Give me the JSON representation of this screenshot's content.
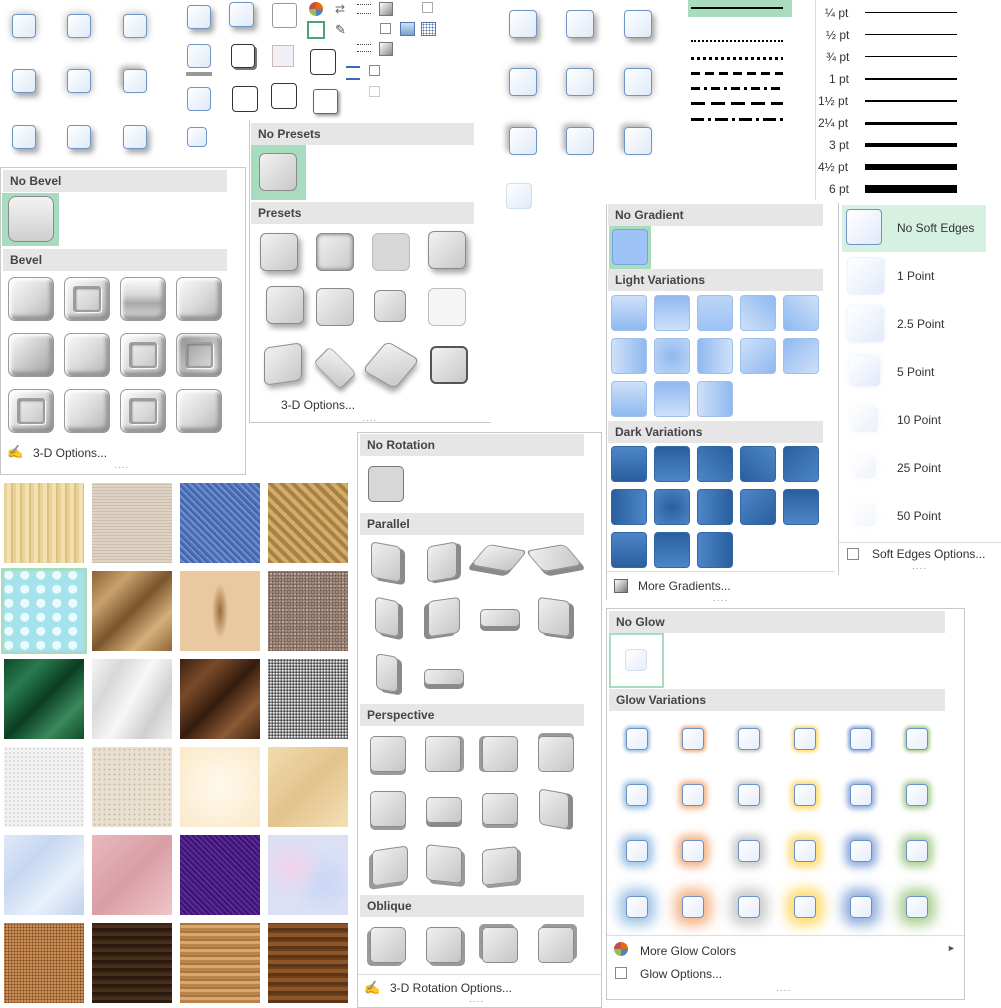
{
  "bevel_panel": {
    "no_bevel": "No Bevel",
    "bevel": "Bevel",
    "options": "3-D Options..."
  },
  "presets_panel": {
    "no_presets": "No Presets",
    "presets": "Presets",
    "options": "3-D Options..."
  },
  "rotation_panel": {
    "no_rotation": "No Rotation",
    "parallel": "Parallel",
    "perspective": "Perspective",
    "oblique": "Oblique",
    "options": "3-D Rotation Options..."
  },
  "gradient_panel": {
    "no_gradient": "No Gradient",
    "light_variations": "Light Variations",
    "dark_variations": "Dark Variations",
    "more": "More Gradients..."
  },
  "glow_panel": {
    "no_glow": "No Glow",
    "glow_variations": "Glow Variations",
    "more_colors": "More Glow Colors",
    "options": "Glow Options...",
    "colors": [
      "#5b9bd5",
      "#ed7d31",
      "#a5a5a5",
      "#ffc000",
      "#4472c4",
      "#70ad47"
    ]
  },
  "soft_edges_panel": {
    "items": [
      "No Soft Edges",
      "1 Point",
      "2.5 Point",
      "5 Point",
      "10 Point",
      "25 Point",
      "50 Point"
    ],
    "options": "Soft Edges Options..."
  },
  "weights": [
    "¼ pt",
    "½ pt",
    "¾ pt",
    "1 pt",
    "1½ pt",
    "2¼ pt",
    "3 pt",
    "4½ pt",
    "6 pt"
  ],
  "dots": "....",
  "textures": [
    "papyrus",
    "canvas",
    "denim",
    "woven-mat",
    "water-droplets",
    "paper-bag",
    "fish-fossil",
    "sand",
    "green-marble",
    "white-marble",
    "brown-marble",
    "granite",
    "newsprint",
    "recycled-paper",
    "parchment",
    "stationery",
    "blue-tissue-paper",
    "pink-tissue-paper",
    "purple-mesh",
    "bouquet",
    "cork",
    "walnut",
    "oak",
    "medium-wood"
  ],
  "accent": "#a8dcbf"
}
